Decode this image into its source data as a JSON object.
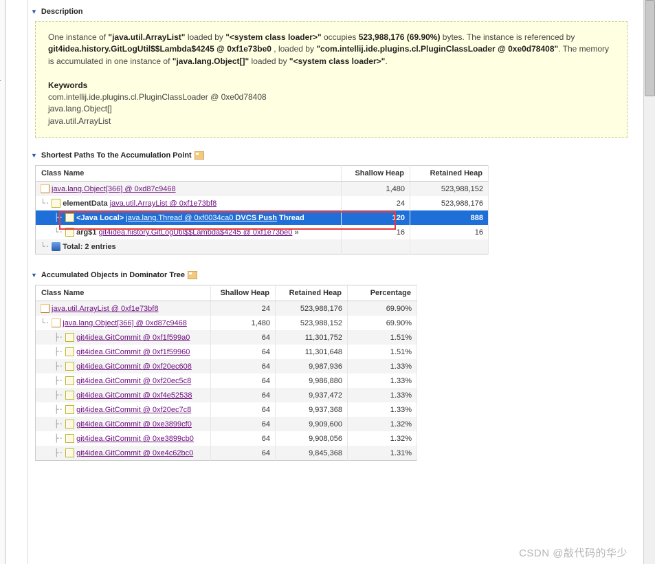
{
  "sections": {
    "desc_title": "Description",
    "paths_title": "Shortest Paths To the Accumulation Point",
    "dom_title": "Accumulated Objects in Dominator Tree"
  },
  "description": {
    "pre1": "One instance of ",
    "b1": "\"java.util.ArrayList\"",
    "mid1": " loaded by ",
    "b2": "\"<system class loader>\"",
    "mid2": " occupies ",
    "b3": "523,988,176 (69.90%)",
    "mid3": " bytes. The instance is referenced by ",
    "b4": "git4idea.history.GitLogUtil$$Lambda$4245 @ 0xf1e73be0",
    "mid4": " , loaded by ",
    "b5": "\"com.intellij.ide.plugins.cl.PluginClassLoader @ 0xe0d78408\"",
    "mid5": ". The memory is accumulated in one instance of ",
    "b6": "\"java.lang.Object[]\"",
    "mid6": " loaded by ",
    "b7": "\"<system class loader>\"",
    "mid7": ".",
    "kw_label": "Keywords",
    "kw1": "com.intellij.ide.plugins.cl.PluginClassLoader @ 0xe0d78408",
    "kw2": "java.lang.Object[]",
    "kw3": "java.util.ArrayList"
  },
  "paths_table": {
    "hdr_class": "Class Name",
    "hdr_sh": "Shallow Heap",
    "hdr_rh": "Retained Heap",
    "r0": {
      "link": "java.lang.Object[366] @ 0xd87c9468",
      "sh": "1,480",
      "rh": "523,988,152"
    },
    "r1": {
      "pre": "elementData",
      "link": "java.util.ArrayList @ 0xf1e73bf8",
      "sh": "24",
      "rh": "523,988,176"
    },
    "r2": {
      "pre": "<Java Local>",
      "link": "java.lang.Thread @ 0xf0034ca0",
      "tail": "DVCS Push",
      "tail2": "Thread",
      "sh": "120",
      "rh": "888"
    },
    "r3": {
      "pre": "arg$1",
      "link": "git4idea.history.GitLogUtil$$Lambda$4245 @ 0xf1e73be0",
      "tail": " »",
      "sh": "16",
      "rh": "16"
    },
    "total": "Total: 2 entries"
  },
  "dom_table": {
    "hdr_class": "Class Name",
    "hdr_sh": "Shallow Heap",
    "hdr_rh": "Retained Heap",
    "hdr_pct": "Percentage",
    "rows": [
      {
        "indent": 0,
        "link": "java.util.ArrayList @ 0xf1e73bf8",
        "sh": "24",
        "rh": "523,988,176",
        "pct": "69.90%",
        "alt": "l"
      },
      {
        "indent": 1,
        "link": "java.lang.Object[366] @ 0xd87c9468",
        "sh": "1,480",
        "rh": "523,988,152",
        "pct": "69.90%",
        "alt": "w"
      },
      {
        "indent": 2,
        "link": "git4idea.GitCommit @ 0xf1f599a0",
        "sh": "64",
        "rh": "11,301,752",
        "pct": "1.51%",
        "alt": "l"
      },
      {
        "indent": 2,
        "link": "git4idea.GitCommit @ 0xf1f59960",
        "sh": "64",
        "rh": "11,301,648",
        "pct": "1.51%",
        "alt": "w"
      },
      {
        "indent": 2,
        "link": "git4idea.GitCommit @ 0xf20ec608",
        "sh": "64",
        "rh": "9,987,936",
        "pct": "1.33%",
        "alt": "l"
      },
      {
        "indent": 2,
        "link": "git4idea.GitCommit @ 0xf20ec5c8",
        "sh": "64",
        "rh": "9,986,880",
        "pct": "1.33%",
        "alt": "w"
      },
      {
        "indent": 2,
        "link": "git4idea.GitCommit @ 0xf4e52538",
        "sh": "64",
        "rh": "9,937,472",
        "pct": "1.33%",
        "alt": "l"
      },
      {
        "indent": 2,
        "link": "git4idea.GitCommit @ 0xf20ec7c8",
        "sh": "64",
        "rh": "9,937,368",
        "pct": "1.33%",
        "alt": "w"
      },
      {
        "indent": 2,
        "link": "git4idea.GitCommit @ 0xe3899cf0",
        "sh": "64",
        "rh": "9,909,600",
        "pct": "1.32%",
        "alt": "l"
      },
      {
        "indent": 2,
        "link": "git4idea.GitCommit @ 0xe3899cb0",
        "sh": "64",
        "rh": "9,908,056",
        "pct": "1.32%",
        "alt": "w"
      },
      {
        "indent": 2,
        "link": "git4idea.GitCommit @ 0xe4c62bc0",
        "sh": "64",
        "rh": "9,845,368",
        "pct": "1.31%",
        "alt": "l"
      }
    ]
  },
  "watermark": "CSDN @敲代码的华少"
}
